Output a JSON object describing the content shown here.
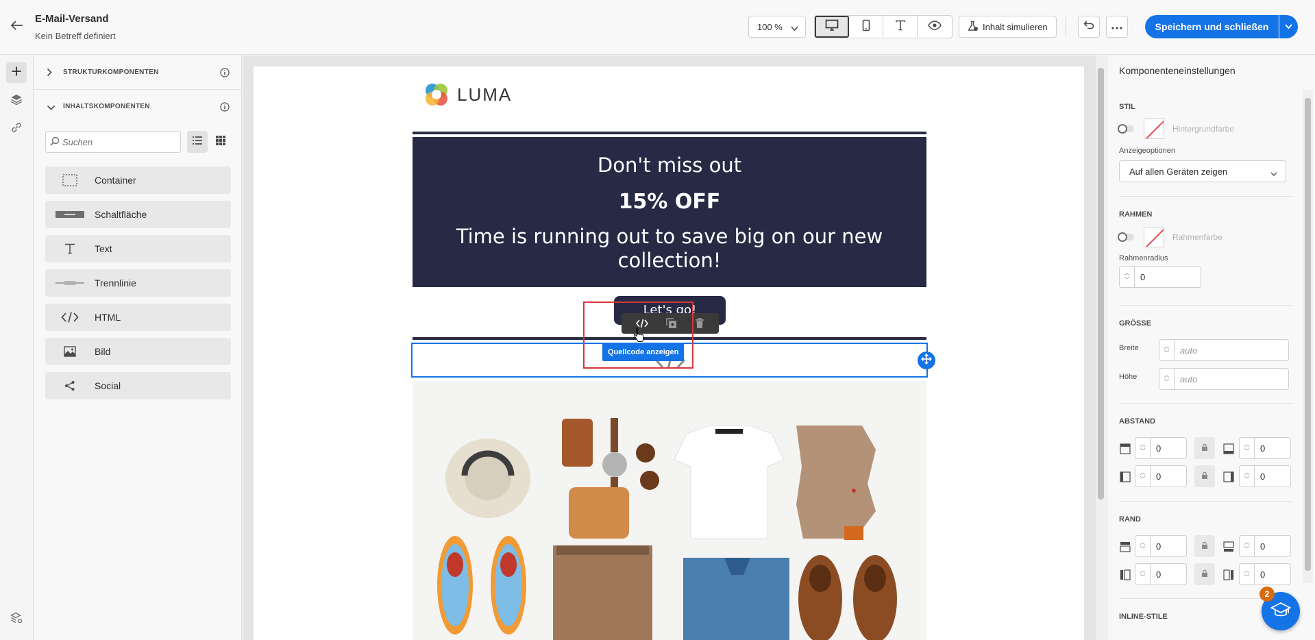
{
  "header": {
    "title": "E-Mail-Versand",
    "subtitle": "Kein Betreff definiert",
    "zoom": "100 %",
    "simulate_label": "Inhalt simulieren",
    "save_label": "Speichern und schließen",
    "view_modes": [
      "desktop-icon",
      "mobile-icon",
      "text-icon",
      "preview-icon"
    ]
  },
  "left_panel": {
    "section_structure": "STRUKTURKOMPONENTEN",
    "section_content": "INHALTSKOMPONENTEN",
    "search_placeholder": "Suchen",
    "components": [
      {
        "label": "Container",
        "icon": "container-icon"
      },
      {
        "label": "Schaltfläche",
        "icon": "button-icon"
      },
      {
        "label": "Text",
        "icon": "text-icon"
      },
      {
        "label": "Trennlinie",
        "icon": "divider-icon"
      },
      {
        "label": "HTML",
        "icon": "code-icon"
      },
      {
        "label": "Bild",
        "icon": "image-icon"
      },
      {
        "label": "Social",
        "icon": "share-icon"
      }
    ]
  },
  "email": {
    "logo_text": "LUMA",
    "banner_line1": "Don't miss out",
    "banner_line2": "15% OFF",
    "banner_line3": "Time is running out to save big on our new collection!",
    "cta_label": "Let's go!",
    "tooltip": "Quellcode anzeigen"
  },
  "right_panel": {
    "title": "Komponenteneinstellungen",
    "stil": "STIL",
    "bg_color_label": "Hintergrundfarbe",
    "display_options_label": "Anzeigeoptionen",
    "display_options_value": "Auf allen Geräten zeigen",
    "rahmen": "RAHMEN",
    "border_color_label": "Rahmenfarbe",
    "border_radius_label": "Rahmenradius",
    "border_radius_value": "0",
    "groesse": "GRÖSSE",
    "width_label": "Breite",
    "width_placeholder": "auto",
    "height_label": "Höhe",
    "height_placeholder": "auto",
    "abstand": "ABSTAND",
    "rand": "RAND",
    "inline_styles": "INLINE-STILE",
    "zero": "0"
  },
  "help_badge": "2",
  "colors": {
    "accent": "#1473e6",
    "banner_bg": "#262a44",
    "highlight": "#d7373f"
  }
}
